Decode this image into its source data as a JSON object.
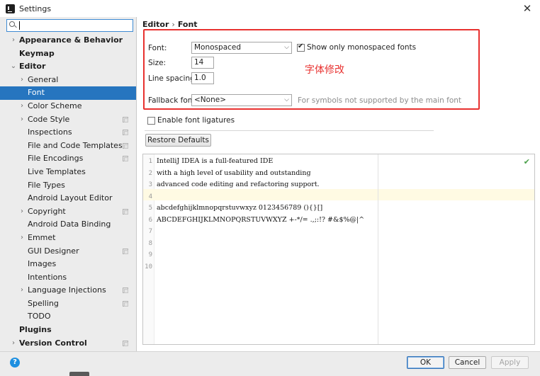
{
  "window": {
    "title": "Settings",
    "close_glyph": "✕"
  },
  "search": {
    "value": "",
    "placeholder": ""
  },
  "sidebar": {
    "items": [
      {
        "label": "Appearance & Behavior",
        "level": 0,
        "expandable": true,
        "expanded": false,
        "bold": true,
        "project": false
      },
      {
        "label": "Keymap",
        "level": 0,
        "expandable": false,
        "bold": true,
        "project": false
      },
      {
        "label": "Editor",
        "level": 0,
        "expandable": true,
        "expanded": true,
        "bold": true,
        "project": false
      },
      {
        "label": "General",
        "level": 1,
        "expandable": true,
        "expanded": false,
        "bold": false,
        "project": false
      },
      {
        "label": "Font",
        "level": 1,
        "expandable": false,
        "bold": false,
        "project": false,
        "selected": true
      },
      {
        "label": "Color Scheme",
        "level": 1,
        "expandable": true,
        "expanded": false,
        "bold": false,
        "project": false
      },
      {
        "label": "Code Style",
        "level": 1,
        "expandable": true,
        "expanded": false,
        "bold": false,
        "project": true
      },
      {
        "label": "Inspections",
        "level": 1,
        "expandable": false,
        "bold": false,
        "project": true
      },
      {
        "label": "File and Code Templates",
        "level": 1,
        "expandable": false,
        "bold": false,
        "project": true
      },
      {
        "label": "File Encodings",
        "level": 1,
        "expandable": false,
        "bold": false,
        "project": true
      },
      {
        "label": "Live Templates",
        "level": 1,
        "expandable": false,
        "bold": false,
        "project": false
      },
      {
        "label": "File Types",
        "level": 1,
        "expandable": false,
        "bold": false,
        "project": false
      },
      {
        "label": "Android Layout Editor",
        "level": 1,
        "expandable": false,
        "bold": false,
        "project": false
      },
      {
        "label": "Copyright",
        "level": 1,
        "expandable": true,
        "expanded": false,
        "bold": false,
        "project": true
      },
      {
        "label": "Android Data Binding",
        "level": 1,
        "expandable": false,
        "bold": false,
        "project": false
      },
      {
        "label": "Emmet",
        "level": 1,
        "expandable": true,
        "expanded": false,
        "bold": false,
        "project": false
      },
      {
        "label": "GUI Designer",
        "level": 1,
        "expandable": false,
        "bold": false,
        "project": true
      },
      {
        "label": "Images",
        "level": 1,
        "expandable": false,
        "bold": false,
        "project": false
      },
      {
        "label": "Intentions",
        "level": 1,
        "expandable": false,
        "bold": false,
        "project": false
      },
      {
        "label": "Language Injections",
        "level": 1,
        "expandable": true,
        "expanded": false,
        "bold": false,
        "project": true
      },
      {
        "label": "Spelling",
        "level": 1,
        "expandable": false,
        "bold": false,
        "project": true
      },
      {
        "label": "TODO",
        "level": 1,
        "expandable": false,
        "bold": false,
        "project": false
      },
      {
        "label": "Plugins",
        "level": 0,
        "expandable": false,
        "bold": true,
        "project": false
      },
      {
        "label": "Version Control",
        "level": 0,
        "expandable": true,
        "expanded": false,
        "bold": true,
        "project": true
      }
    ]
  },
  "breadcrumb": {
    "parent": "Editor",
    "separator": "›",
    "current": "Font"
  },
  "font_settings": {
    "font_label": "Font:",
    "font_value": "Monospaced",
    "show_mono_label": "Show only monospaced fonts",
    "show_mono_checked": true,
    "size_label": "Size:",
    "size_value": "14",
    "spacing_label": "Line spacing:",
    "spacing_value": "1.0",
    "fallback_label": "Fallback font:",
    "fallback_value": "<None>",
    "fallback_hint": "For symbols not supported by the main font",
    "annotation": "字体修改",
    "ligatures_label": "Enable font ligatures",
    "ligatures_checked": false,
    "restore_label": "Restore Defaults"
  },
  "preview": {
    "lines": [
      {
        "n": "1",
        "text": "IntelliJ IDEA is a full-featured IDE"
      },
      {
        "n": "2",
        "text": "with a high level of usability and outstanding"
      },
      {
        "n": "3",
        "text": "advanced code editing and refactoring support."
      },
      {
        "n": "4",
        "text": ""
      },
      {
        "n": "5",
        "text": "abcdefghijklmnopqrstuvwxyz 0123456789 (){}[]"
      },
      {
        "n": "6",
        "text": "ABCDEFGHIJKLMNOPQRSTUVWXYZ +-*/= .,;:!? #&$%@|^"
      },
      {
        "n": "7",
        "text": ""
      },
      {
        "n": "8",
        "text": ""
      },
      {
        "n": "9",
        "text": ""
      },
      {
        "n": "10",
        "text": ""
      }
    ]
  },
  "footer": {
    "help": "?",
    "ok": "OK",
    "cancel": "Cancel",
    "apply": "Apply"
  },
  "colors": {
    "accent": "#2675bf",
    "annotation": "#e8312f"
  }
}
